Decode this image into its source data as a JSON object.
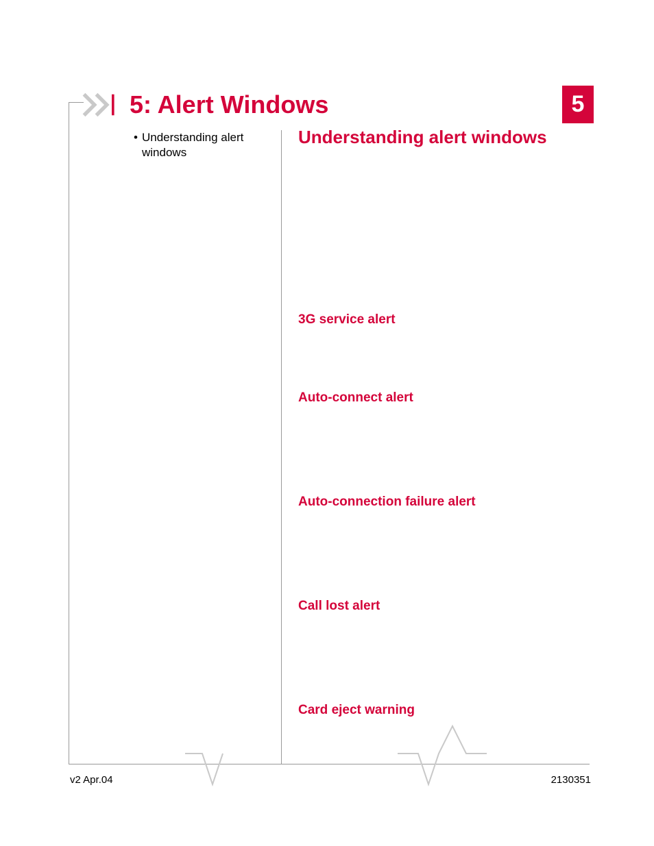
{
  "chapter": {
    "number": "5",
    "title": "5: Alert Windows"
  },
  "toc": {
    "items": [
      {
        "label": "Understanding alert windows"
      }
    ]
  },
  "section": {
    "title": "Understanding alert windows",
    "alerts": [
      "3G service alert",
      "Auto-connect alert",
      "Auto-connection failure alert",
      "Call lost alert",
      "Card eject warning"
    ]
  },
  "footer": {
    "left": "v2  Apr.04",
    "right": "2130351"
  }
}
